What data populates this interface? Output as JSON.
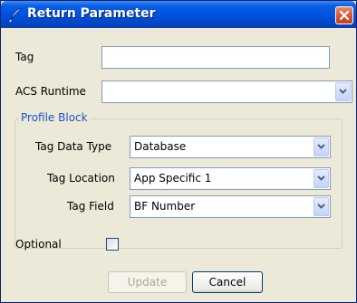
{
  "window": {
    "title": "Return Parameter"
  },
  "form": {
    "tag_label": "Tag",
    "tag_value": "",
    "acs_runtime_label": "ACS Runtime",
    "acs_runtime_value": "",
    "profile_block": {
      "title": "Profile Block",
      "tag_data_type_label": "Tag Data Type",
      "tag_data_type_value": "Database",
      "tag_location_label": "Tag Location",
      "tag_location_value": "App Specific 1",
      "tag_field_label": "Tag Field",
      "tag_field_value": "BF Number"
    },
    "optional_label": "Optional",
    "optional_checked": false
  },
  "buttons": {
    "update": "Update",
    "cancel": "Cancel"
  },
  "colors": {
    "title_bar": "#0054e3",
    "close_button": "#d9512c",
    "group_title": "#1a55c5",
    "dialog_bg": "#ece9d8"
  },
  "icons": {
    "title": "quill-pen-icon",
    "close": "close-icon",
    "dropdown": "chevron-down-icon"
  }
}
